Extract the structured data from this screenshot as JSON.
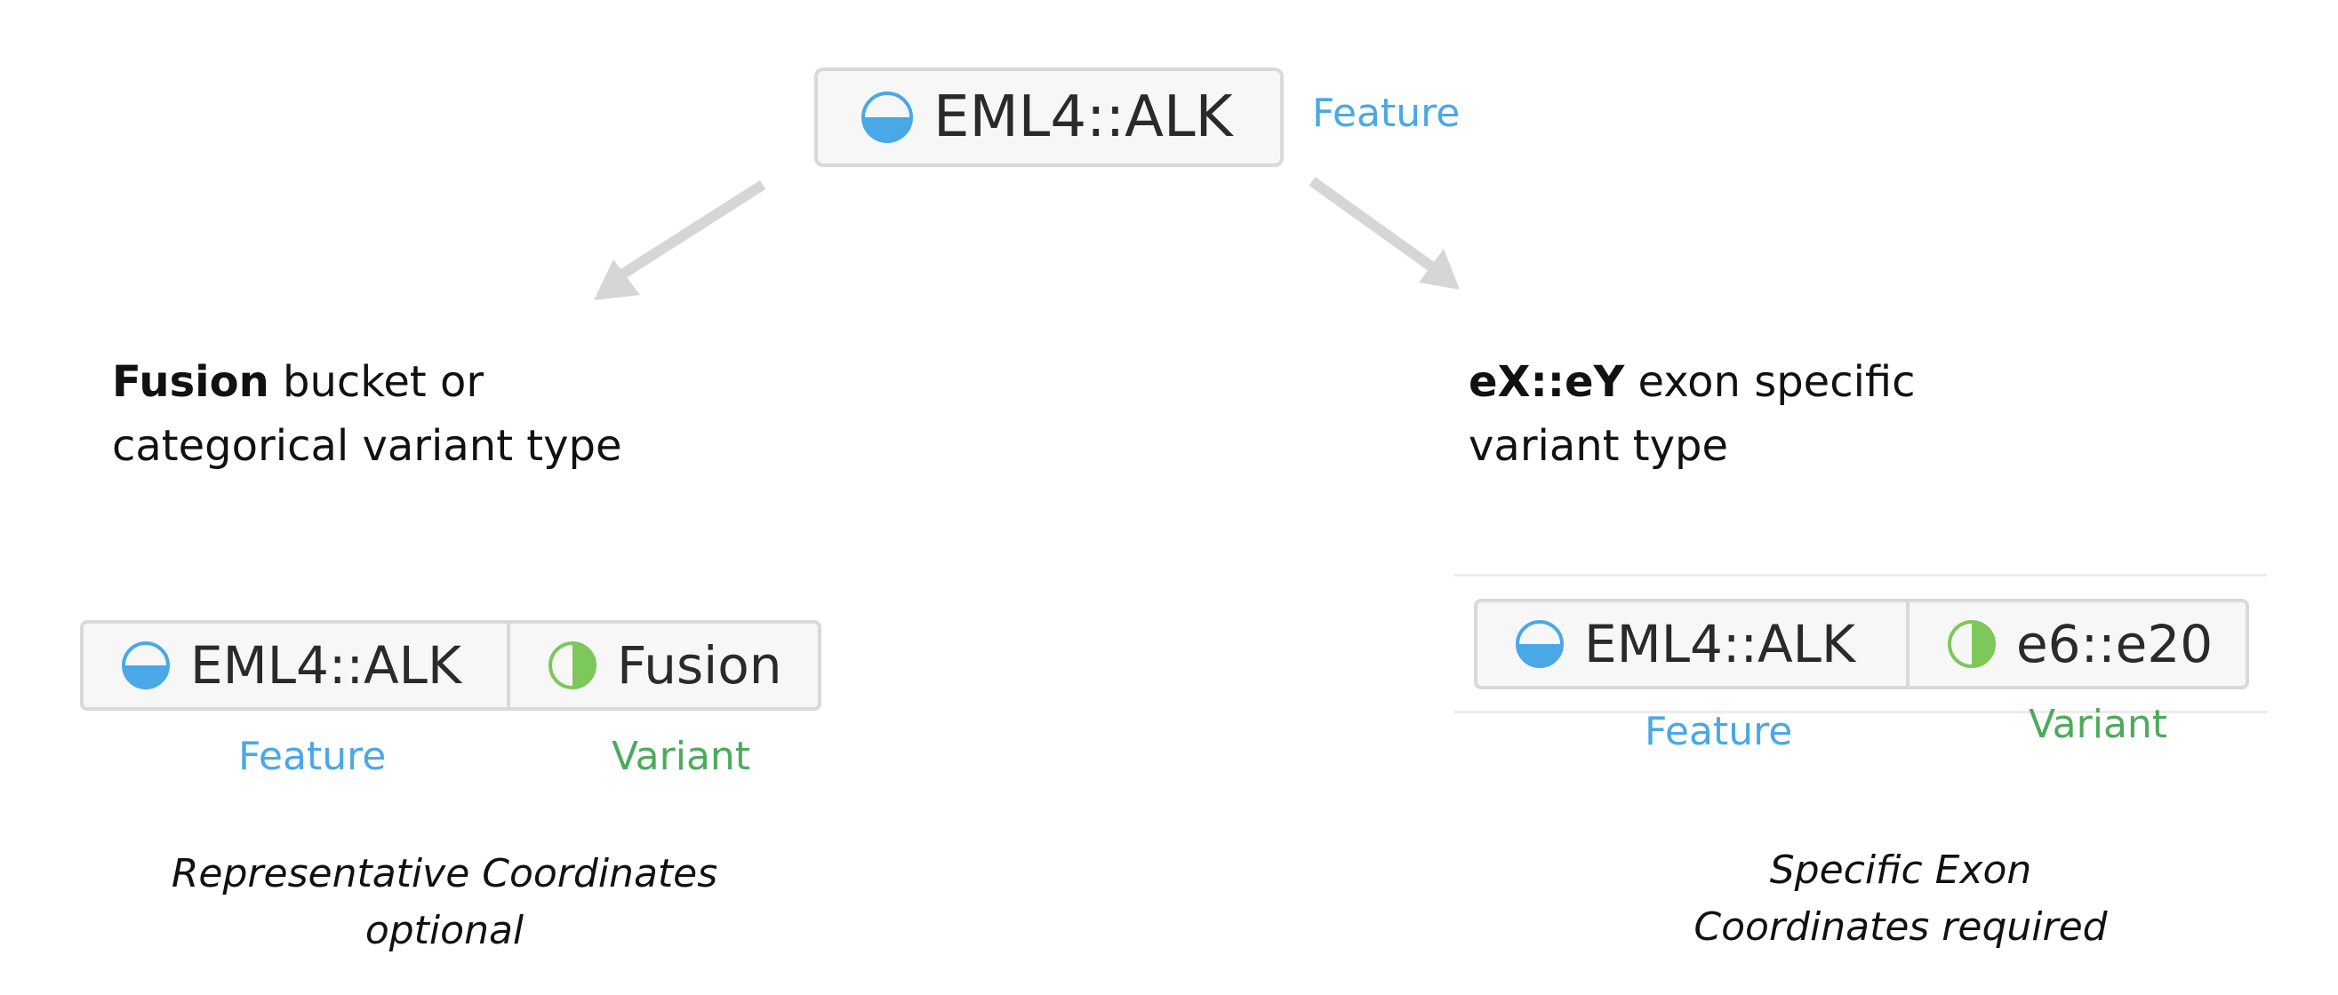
{
  "colors": {
    "feature": "#4aa8e6",
    "variant": "#4cab5a",
    "arrow": "#d6d6d6",
    "tag_border": "#d9d9d9",
    "tag_fill": "#f7f7f7"
  },
  "top": {
    "tag": {
      "icon": "half-filled-circle-bottom-icon",
      "label": "EML4::ALK"
    },
    "caption": "Feature"
  },
  "left": {
    "heading_bold": "Fusion",
    "heading_line1_rest": " bucket or",
    "heading_line2": "categorical variant type",
    "feature_tag": {
      "icon": "half-filled-circle-bottom-icon",
      "label": "EML4::ALK"
    },
    "variant_tag": {
      "icon": "half-filled-circle-right-icon",
      "label": "Fusion"
    },
    "feature_caption": "Feature",
    "variant_caption": "Variant",
    "note_line1": "Representative Coordinates",
    "note_line2": "optional"
  },
  "right": {
    "heading_bold": "eX::eY",
    "heading_line1_rest": " exon specific",
    "heading_line2": "variant type",
    "feature_tag": {
      "icon": "half-filled-circle-bottom-icon",
      "label": "EML4::ALK"
    },
    "variant_tag": {
      "icon": "half-filled-circle-right-icon",
      "label": "e6::e20"
    },
    "feature_caption": "Feature",
    "variant_caption": "Variant",
    "note_line1": "Specific Exon",
    "note_line2": "Coordinates required"
  }
}
